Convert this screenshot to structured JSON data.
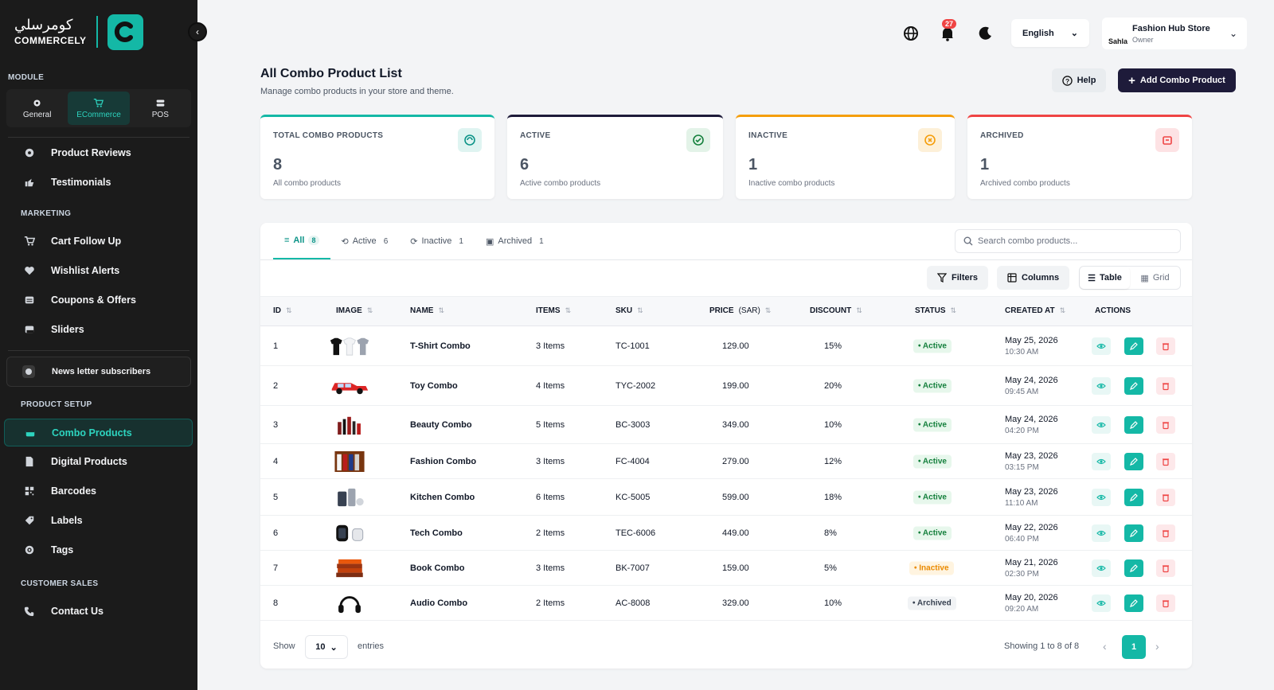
{
  "brand": {
    "name_ar": "كومرسلي",
    "name_en": "COMMERCELY"
  },
  "sidebar": {
    "module_label": "MODULE",
    "modules": [
      {
        "label": "General",
        "icon": "gear-icon"
      },
      {
        "label": "ECommerce",
        "icon": "cart-icon",
        "active": true
      },
      {
        "label": "POS",
        "icon": "pos-icon"
      }
    ],
    "items_top": [
      {
        "label": "Product Reviews",
        "icon": "gear-icon"
      },
      {
        "label": "Testimonials",
        "icon": "thumbs-up-icon"
      }
    ],
    "marketing_label": "MARKETING",
    "marketing": [
      {
        "label": "Cart Follow Up",
        "icon": "cart-icon"
      },
      {
        "label": "Wishlist Alerts",
        "icon": "heart-icon"
      },
      {
        "label": "Coupons & Offers",
        "icon": "coupon-icon"
      },
      {
        "label": "Sliders",
        "icon": "slider-icon"
      }
    ],
    "newsletter": "News letter subscribers",
    "product_setup_label": "PRODUCT SETUP",
    "product_setup": [
      {
        "label": "Combo Products",
        "icon": "box-icon",
        "active": true
      },
      {
        "label": "Digital Products",
        "icon": "file-icon"
      },
      {
        "label": "Barcodes",
        "icon": "barcode-icon"
      },
      {
        "label": "Labels",
        "icon": "label-icon"
      },
      {
        "label": "Tags",
        "icon": "tag-icon"
      }
    ],
    "customer_sales_label": "CUSTOMER SALES",
    "customer_sales": [
      {
        "label": "Contact Us",
        "icon": "phone-icon"
      }
    ]
  },
  "header": {
    "notification_count": "27",
    "language": "English",
    "store_avatar": "Sahla",
    "store_name": "Fashion Hub Store",
    "store_role": "Owner"
  },
  "page": {
    "title": "All Combo Product List",
    "subtitle": "Manage combo products in your store and theme.",
    "help_label": "Help",
    "add_label": "Add Combo Product"
  },
  "stats": [
    {
      "label": "TOTAL COMBO PRODUCTS",
      "value": "8",
      "desc": "All combo products",
      "color": "#14b8a6"
    },
    {
      "label": "ACTIVE",
      "value": "6",
      "desc": "Active combo products",
      "color": "#1e1b3a"
    },
    {
      "label": "INACTIVE",
      "value": "1",
      "desc": "Inactive combo products",
      "color": "#f59e0b"
    },
    {
      "label": "ARCHIVED",
      "value": "1",
      "desc": "Archived combo products",
      "color": "#ef4444"
    }
  ],
  "tabs": [
    {
      "label": "All",
      "count": "8"
    },
    {
      "label": "Active",
      "count": "6"
    },
    {
      "label": "Inactive",
      "count": "1"
    },
    {
      "label": "Archived",
      "count": "1"
    }
  ],
  "search_placeholder": "Search combo products...",
  "toolbar": {
    "filters": "Filters",
    "columns": "Columns",
    "table": "Table",
    "grid": "Grid"
  },
  "columns": [
    "ID",
    "IMAGE",
    "NAME",
    "ITEMS",
    "SKU",
    "PRICE",
    "DISCOUNT",
    "STATUS",
    "CREATED AT",
    "ACTIONS"
  ],
  "price_unit": "(SAR)",
  "rows": [
    {
      "id": "1",
      "name": "T-Shirt Combo",
      "items": "3 Items",
      "sku": "TC-1001",
      "price": "129.00",
      "discount": "15%",
      "status": "Active",
      "date": "May 25, 2026",
      "time": "10:30 AM",
      "thumb": "tshirt"
    },
    {
      "id": "2",
      "name": "Toy Combo",
      "items": "4 Items",
      "sku": "TYC-2002",
      "price": "199.00",
      "discount": "20%",
      "status": "Active",
      "date": "May 24, 2026",
      "time": "09:45 AM",
      "thumb": "car"
    },
    {
      "id": "3",
      "name": "Beauty Combo",
      "items": "5 Items",
      "sku": "BC-3003",
      "price": "349.00",
      "discount": "10%",
      "status": "Active",
      "date": "May 24, 2026",
      "time": "04:20 PM",
      "thumb": "beauty"
    },
    {
      "id": "4",
      "name": "Fashion Combo",
      "items": "3 Items",
      "sku": "FC-4004",
      "price": "279.00",
      "discount": "12%",
      "status": "Active",
      "date": "May 23, 2026",
      "time": "03:15 PM",
      "thumb": "fashion"
    },
    {
      "id": "5",
      "name": "Kitchen Combo",
      "items": "6 Items",
      "sku": "KC-5005",
      "price": "599.00",
      "discount": "18%",
      "status": "Active",
      "date": "May 23, 2026",
      "time": "11:10 AM",
      "thumb": "kitchen"
    },
    {
      "id": "6",
      "name": "Tech Combo",
      "items": "2 Items",
      "sku": "TEC-6006",
      "price": "449.00",
      "discount": "8%",
      "status": "Active",
      "date": "May 22, 2026",
      "time": "06:40 PM",
      "thumb": "tech"
    },
    {
      "id": "7",
      "name": "Book Combo",
      "items": "3 Items",
      "sku": "BK-7007",
      "price": "159.00",
      "discount": "5%",
      "status": "Inactive",
      "date": "May 21, 2026",
      "time": "02:30 PM",
      "thumb": "books"
    },
    {
      "id": "8",
      "name": "Audio Combo",
      "items": "2 Items",
      "sku": "AC-8008",
      "price": "329.00",
      "discount": "10%",
      "status": "Archived",
      "date": "May 20, 2026",
      "time": "09:20 AM",
      "thumb": "headphones"
    }
  ],
  "footer": {
    "show": "Show",
    "per_page": "10",
    "entries": "entries",
    "showing": "Showing 1 to 8 of 8",
    "page": "1"
  }
}
